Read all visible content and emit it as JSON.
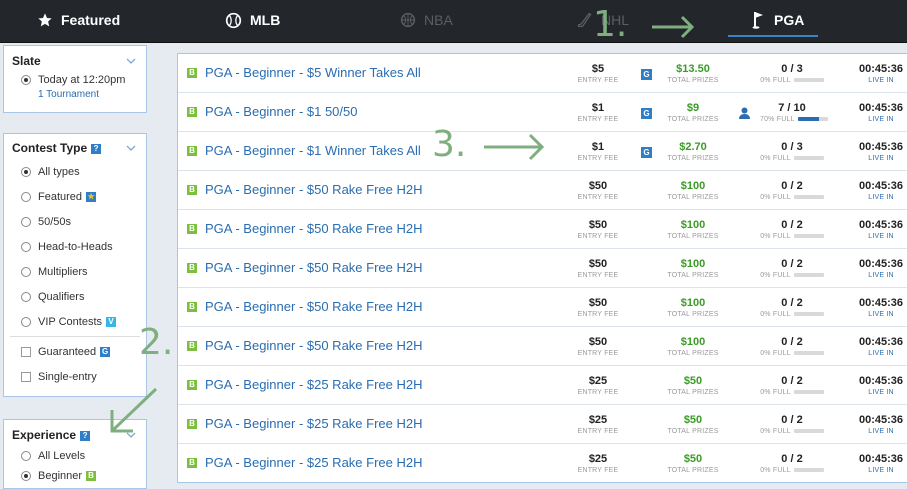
{
  "nav": {
    "tabs": [
      {
        "label": "Featured",
        "icon": "star-icon",
        "active": false,
        "disabled": false
      },
      {
        "label": "MLB",
        "icon": "baseball-icon",
        "active": false,
        "disabled": false
      },
      {
        "label": "NBA",
        "icon": "basketball-icon",
        "active": false,
        "disabled": true
      },
      {
        "label": "NHL",
        "icon": "hockey-stick-icon",
        "active": false,
        "disabled": true
      },
      {
        "label": "PGA",
        "icon": "golf-flag-icon",
        "active": true,
        "disabled": false
      }
    ]
  },
  "sidebar": {
    "slate": {
      "title": "Slate",
      "option": "Today at 12:20pm",
      "sub": "1 Tournament"
    },
    "contest_type": {
      "title": "Contest Type",
      "help": "?",
      "options": [
        {
          "label": "All types",
          "selected": true
        },
        {
          "label": "Featured",
          "selected": false
        },
        {
          "label": "50/50s",
          "selected": false
        },
        {
          "label": "Head-to-Heads",
          "selected": false
        },
        {
          "label": "Multipliers",
          "selected": false
        },
        {
          "label": "Qualifiers",
          "selected": false
        },
        {
          "label": "VIP Contests",
          "selected": false
        }
      ],
      "checks": [
        {
          "label": "Guaranteed",
          "checked": false
        },
        {
          "label": "Single-entry",
          "checked": false
        }
      ],
      "badges": {
        "featured": "★",
        "vip": "V",
        "guaranteed": "G"
      }
    },
    "experience": {
      "title": "Experience",
      "help": "?",
      "options": [
        {
          "label": "All Levels",
          "selected": false
        },
        {
          "label": "Beginner",
          "selected": true
        }
      ],
      "beginner_badge": "B"
    }
  },
  "contests": {
    "labels": {
      "fee": "ENTRY FEE",
      "prizes": "TOTAL PRIZES",
      "live": "LIVE IN",
      "badge": "B",
      "guaranteed": "G"
    },
    "rows": [
      {
        "name": "PGA - Beginner - $5 Winner Takes All",
        "fee": "$5",
        "guaranteed": true,
        "prize": "$13.50",
        "entries": "0 / 3",
        "pct_label": "0% FULL",
        "pct": 0,
        "person": false,
        "time": "00:45:36"
      },
      {
        "name": "PGA - Beginner - $1 50/50",
        "fee": "$1",
        "guaranteed": true,
        "prize": "$9",
        "entries": "7 / 10",
        "pct_label": "70% FULL",
        "pct": 70,
        "person": true,
        "time": "00:45:36"
      },
      {
        "name": "PGA - Beginner - $1 Winner Takes All",
        "fee": "$1",
        "guaranteed": true,
        "prize": "$2.70",
        "entries": "0 / 3",
        "pct_label": "0% FULL",
        "pct": 0,
        "person": false,
        "time": "00:45:36"
      },
      {
        "name": "PGA - Beginner - $50 Rake Free H2H",
        "fee": "$50",
        "guaranteed": false,
        "prize": "$100",
        "entries": "0 / 2",
        "pct_label": "0% FULL",
        "pct": 0,
        "person": false,
        "time": "00:45:36"
      },
      {
        "name": "PGA - Beginner - $50 Rake Free H2H",
        "fee": "$50",
        "guaranteed": false,
        "prize": "$100",
        "entries": "0 / 2",
        "pct_label": "0% FULL",
        "pct": 0,
        "person": false,
        "time": "00:45:36"
      },
      {
        "name": "PGA - Beginner - $50 Rake Free H2H",
        "fee": "$50",
        "guaranteed": false,
        "prize": "$100",
        "entries": "0 / 2",
        "pct_label": "0% FULL",
        "pct": 0,
        "person": false,
        "time": "00:45:36"
      },
      {
        "name": "PGA - Beginner - $50 Rake Free H2H",
        "fee": "$50",
        "guaranteed": false,
        "prize": "$100",
        "entries": "0 / 2",
        "pct_label": "0% FULL",
        "pct": 0,
        "person": false,
        "time": "00:45:36"
      },
      {
        "name": "PGA - Beginner - $50 Rake Free H2H",
        "fee": "$50",
        "guaranteed": false,
        "prize": "$100",
        "entries": "0 / 2",
        "pct_label": "0% FULL",
        "pct": 0,
        "person": false,
        "time": "00:45:36"
      },
      {
        "name": "PGA - Beginner - $25 Rake Free H2H",
        "fee": "$25",
        "guaranteed": false,
        "prize": "$50",
        "entries": "0 / 2",
        "pct_label": "0% FULL",
        "pct": 0,
        "person": false,
        "time": "00:45:36"
      },
      {
        "name": "PGA - Beginner - $25 Rake Free H2H",
        "fee": "$25",
        "guaranteed": false,
        "prize": "$50",
        "entries": "0 / 2",
        "pct_label": "0% FULL",
        "pct": 0,
        "person": false,
        "time": "00:45:36"
      },
      {
        "name": "PGA - Beginner - $25 Rake Free H2H",
        "fee": "$25",
        "guaranteed": false,
        "prize": "$50",
        "entries": "0 / 2",
        "pct_label": "0% FULL",
        "pct": 0,
        "person": false,
        "time": "00:45:36"
      }
    ]
  },
  "annotations": {
    "step1": "1.",
    "step2": "2.",
    "step3": "3.",
    "color": "#7fae7f"
  },
  "colors": {
    "nav_bg": "#23272c",
    "link": "#2a6db0",
    "prize_green": "#3a9c26",
    "beginner_green": "#7cbf3e",
    "guaranteed_blue": "#2f7ec7"
  }
}
